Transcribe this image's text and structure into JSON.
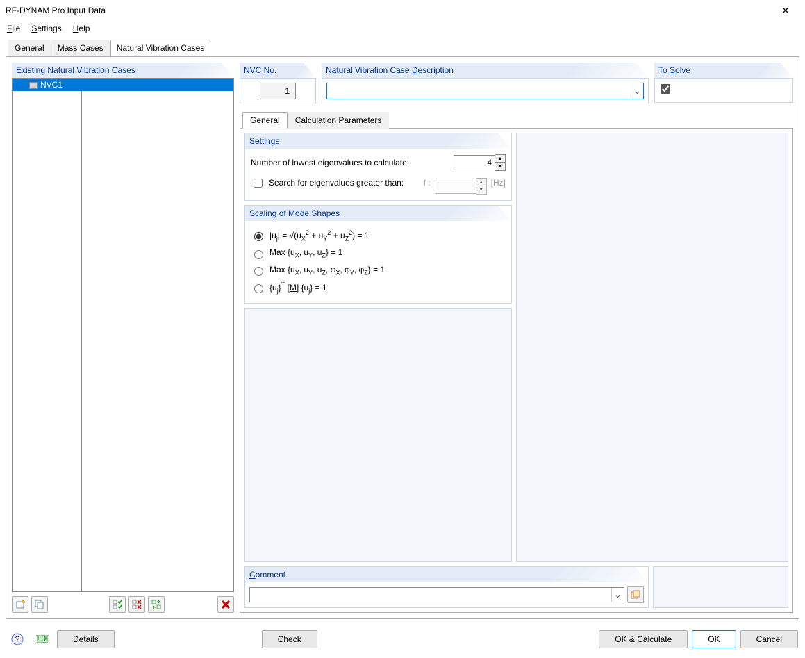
{
  "window": {
    "title": "RF-DYNAM Pro Input Data"
  },
  "menu": {
    "file": "File",
    "settings": "Settings",
    "help": "Help"
  },
  "main_tabs": {
    "general": "General",
    "mass_cases": "Mass Cases",
    "nvc": "Natural Vibration Cases",
    "active": "nvc"
  },
  "left": {
    "header": "Existing Natural Vibration Cases",
    "items": [
      {
        "num": "NVC1",
        "desc": ""
      }
    ]
  },
  "nvc_no": {
    "label": "NVC No.",
    "value": "1"
  },
  "nvc_desc": {
    "label": "Natural Vibration Case Description",
    "value": ""
  },
  "to_solve": {
    "label": "To Solve",
    "checked": true
  },
  "sub_tabs": {
    "general": "General",
    "calc": "Calculation Parameters",
    "active": "general"
  },
  "settings": {
    "header": "Settings",
    "num_eigen_label": "Number of lowest eigenvalues to calculate:",
    "num_eigen_value": "4",
    "search_gt_label": "Search for eigenvalues greater than:",
    "search_gt_checked": false,
    "f_label": "f :",
    "f_value": "",
    "f_unit": "[Hz]"
  },
  "scaling": {
    "header": "Scaling of Mode Shapes",
    "selected": 0
  },
  "comment": {
    "header": "Comment",
    "value": ""
  },
  "footer": {
    "details": "Details",
    "check": "Check",
    "ok_calc": "OK & Calculate",
    "ok": "OK",
    "cancel": "Cancel"
  }
}
